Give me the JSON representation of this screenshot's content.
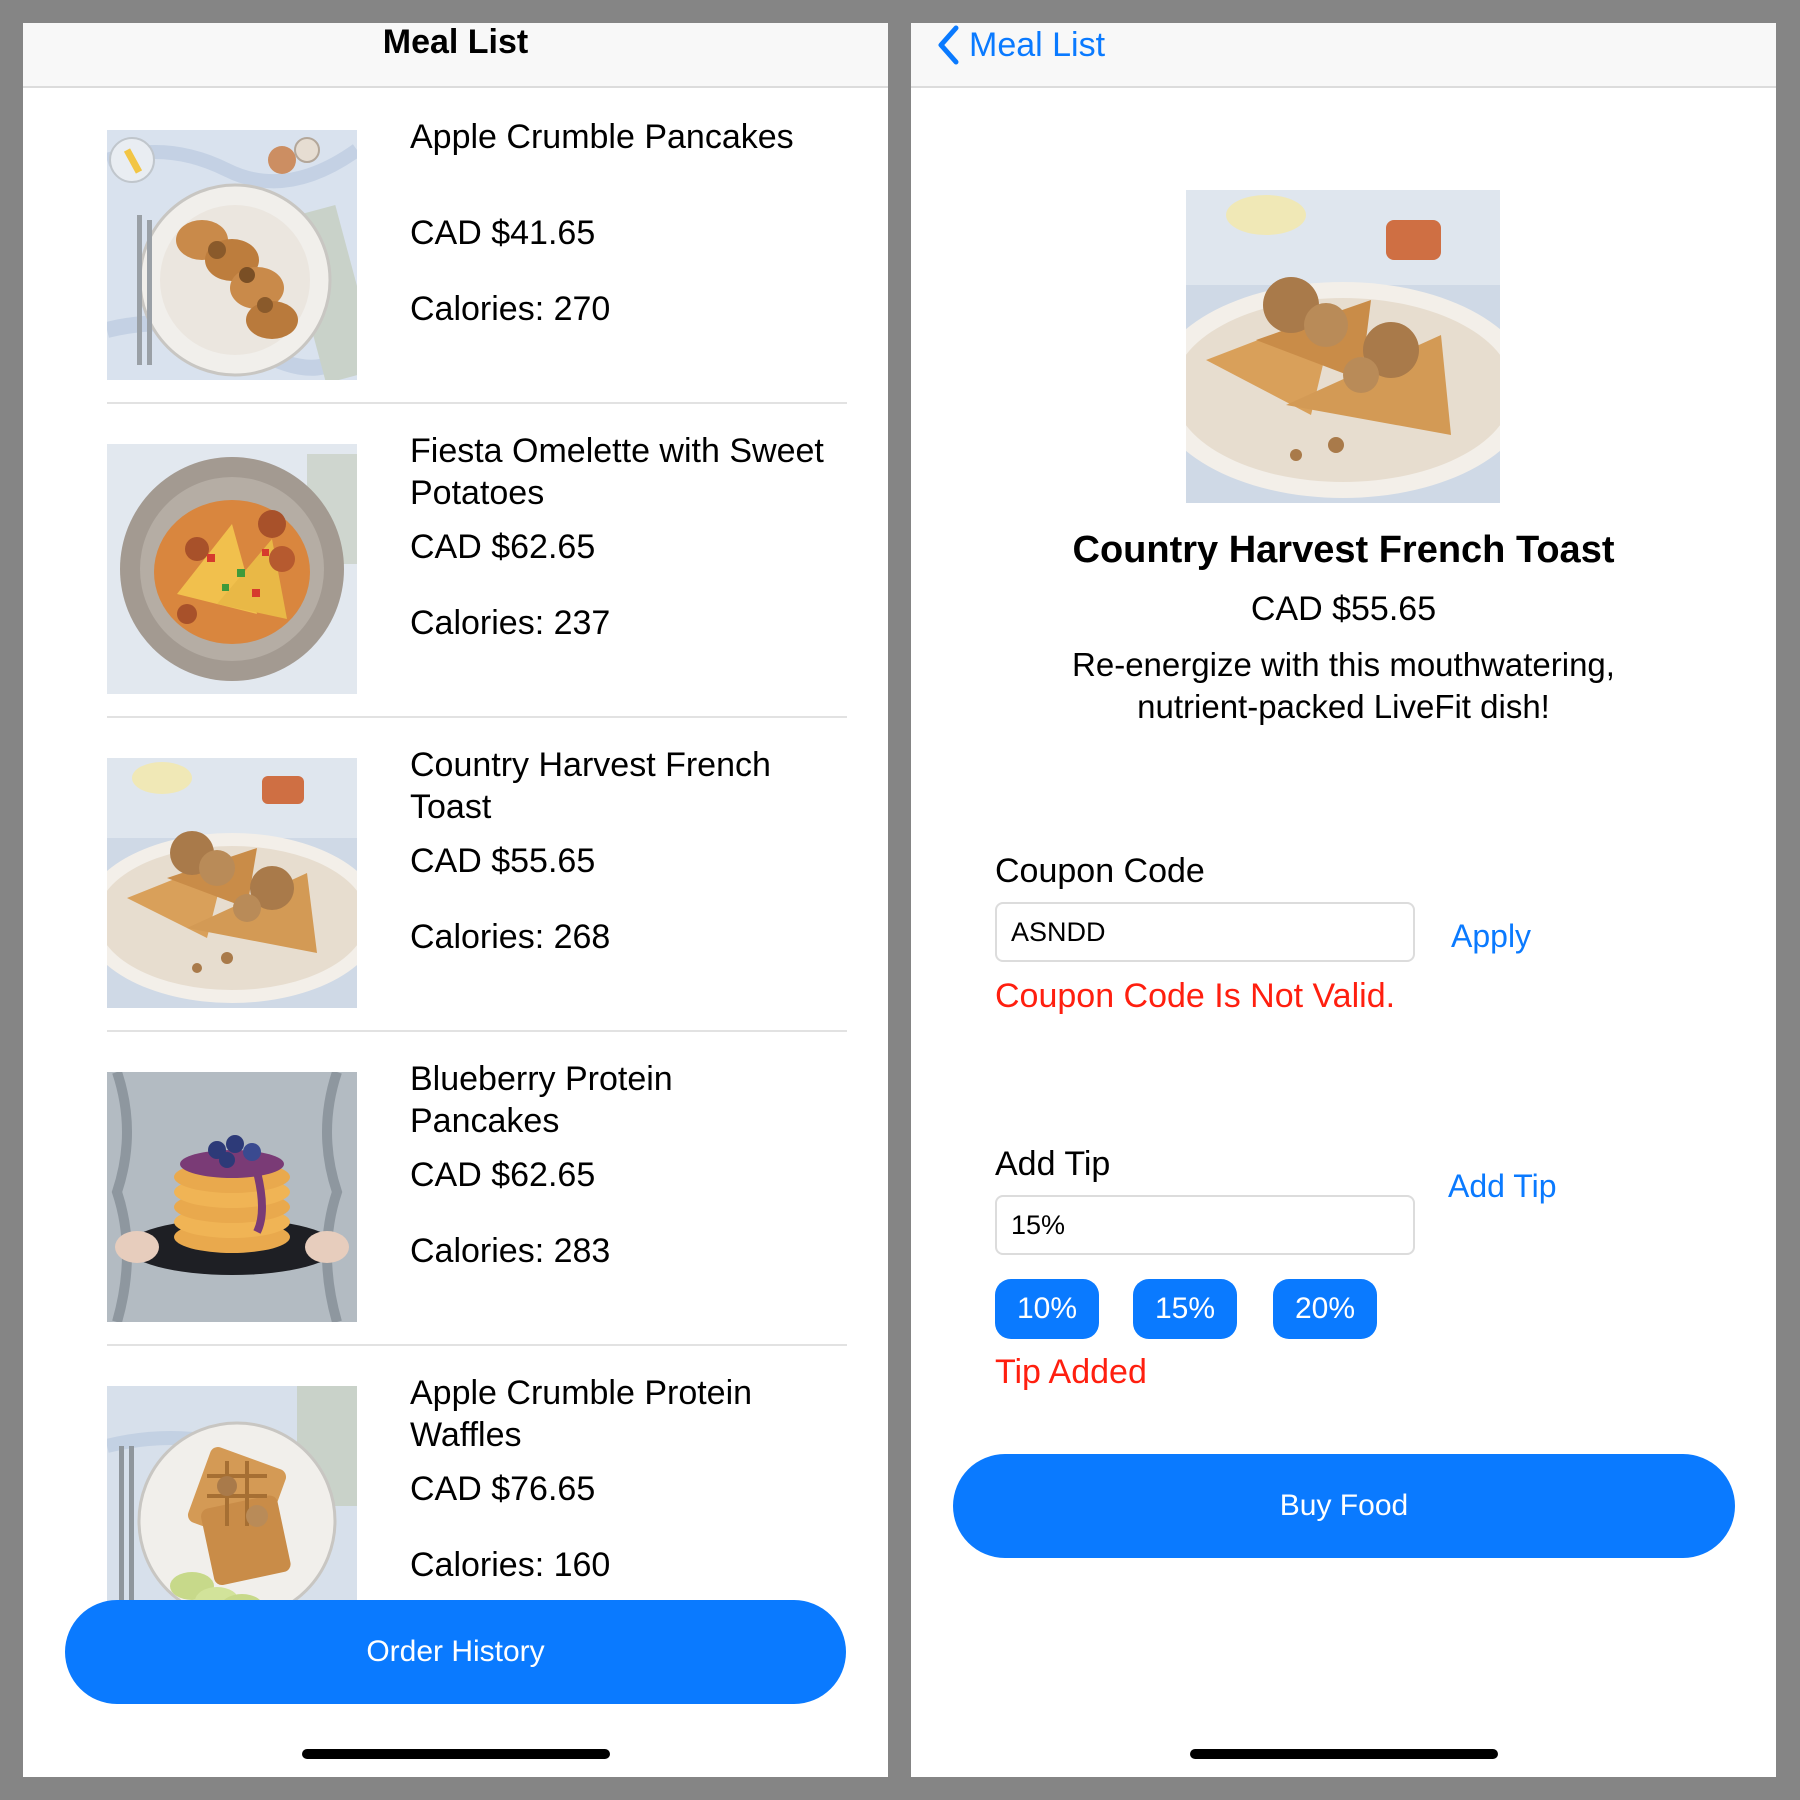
{
  "left_screen": {
    "nav_title": "Meal List",
    "meals": [
      {
        "name": "Apple Crumble Pancakes",
        "price": "CAD $41.65",
        "calories": "Calories: 270",
        "image": "pancakes-photo"
      },
      {
        "name": "Fiesta Omelette with Sweet Potatoes",
        "price": "CAD $62.65",
        "calories": "Calories: 237",
        "image": "omelette-photo"
      },
      {
        "name": "Country Harvest French Toast",
        "price": "CAD $55.65",
        "calories": "Calories: 268",
        "image": "french-toast-photo"
      },
      {
        "name": "Blueberry Protein Pancakes",
        "price": "CAD $62.65",
        "calories": "Calories: 283",
        "image": "blueberry-pancakes-photo"
      },
      {
        "name": "Apple Crumble Protein Waffles",
        "price": "CAD $76.65",
        "calories": "Calories: 160",
        "image": "waffles-photo"
      }
    ],
    "order_history_label": "Order History"
  },
  "right_screen": {
    "back_label": "Meal List",
    "meal_title": "Country Harvest French Toast",
    "meal_price": "CAD $55.65",
    "meal_description": "Re-energize with this mouthwatering, nutrient-packed LiveFit dish!",
    "coupon": {
      "label": "Coupon Code",
      "value": "ASNDD",
      "apply_label": "Apply",
      "error": "Coupon Code Is Not Valid."
    },
    "tip": {
      "label": "Add Tip",
      "value": "15%",
      "add_label": "Add Tip",
      "options": [
        "10%",
        "15%",
        "20%"
      ],
      "status": "Tip Added"
    },
    "buy_label": "Buy Food"
  },
  "colors": {
    "accent": "#0a7aff",
    "error": "#ff1f0f",
    "frame": "#858585"
  }
}
